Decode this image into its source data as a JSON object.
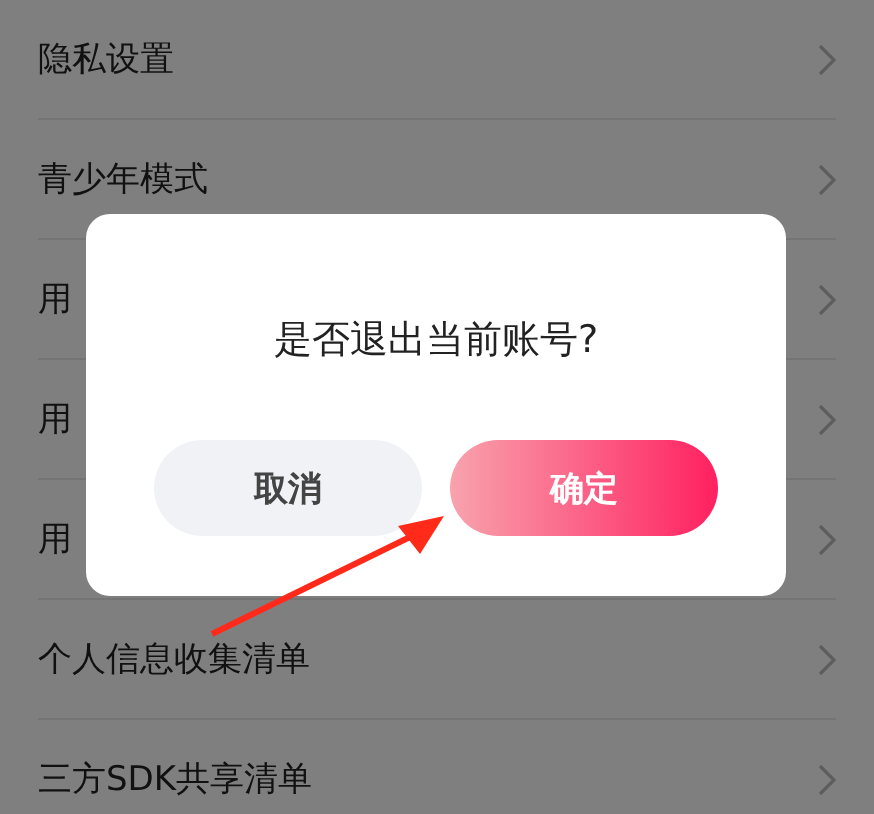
{
  "settings": [
    {
      "label": "隐私设置"
    },
    {
      "label": "青少年模式"
    },
    {
      "label": "用"
    },
    {
      "label": "用"
    },
    {
      "label": "用"
    },
    {
      "label": "个人信息收集清单"
    },
    {
      "label": "三方SDK共享清单"
    }
  ],
  "dialog": {
    "message": "是否退出当前账号?",
    "buttons": [
      {
        "label": "取消",
        "kind": "cancel"
      },
      {
        "label": "确定",
        "kind": "confirm"
      }
    ]
  }
}
